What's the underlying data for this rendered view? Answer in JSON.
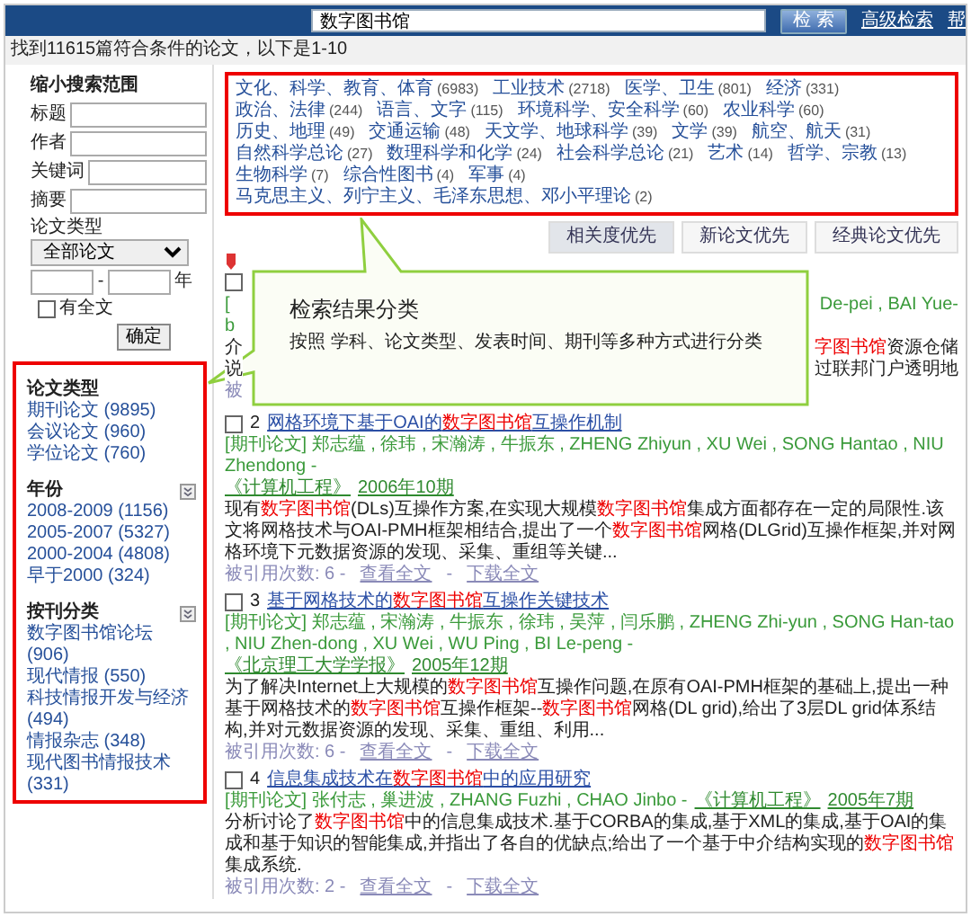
{
  "header": {
    "search_value": "数字图书馆",
    "search_button": "检 索",
    "links": [
      "高级检索",
      "帮"
    ]
  },
  "summary": "找到11615篇符合条件的论文，以下是1-10",
  "filter_form": {
    "title": "缩小搜索范围",
    "fields": [
      {
        "label": "标题"
      },
      {
        "label": "作者"
      },
      {
        "label": "关键词"
      },
      {
        "label": "摘要"
      }
    ],
    "type_label": "论文类型",
    "type_select": "全部论文",
    "year_separator": "-",
    "year_suffix": "年",
    "fulltext": {
      "label": "有全文",
      "checked": false
    },
    "submit": "确定"
  },
  "facets": [
    {
      "title": "论文类型",
      "collapsible": false,
      "items": [
        "期刊论文 (9895)",
        "会议论文 (960)",
        "学位论文 (760)"
      ]
    },
    {
      "title": "年份",
      "collapsible": true,
      "items": [
        "2008-2009 (1156)",
        "2005-2007 (5327)",
        "2000-2004 (4808)",
        "早于2000 (324)"
      ]
    },
    {
      "title": "按刊分类",
      "collapsible": true,
      "items": [
        "数字图书馆论坛 (906)",
        "现代情报 (550)",
        "科技情报开发与经济 (494)",
        "情报杂志 (348)",
        "现代图书情报技术 (331)"
      ]
    }
  ],
  "categories": [
    {
      "name": "文化、科学、教育、体育",
      "count": "(6983)"
    },
    {
      "name": "工业技术",
      "count": "(2718)"
    },
    {
      "name": "医学、卫生",
      "count": "(801)"
    },
    {
      "name": "经济",
      "count": "(331)"
    },
    {
      "name": "政治、法律",
      "count": "(244)"
    },
    {
      "name": "语言、文字",
      "count": "(115)"
    },
    {
      "name": "环境科学、安全科学",
      "count": "(60)"
    },
    {
      "name": "农业科学",
      "count": "(60)"
    },
    {
      "name": "历史、地理",
      "count": "(49)"
    },
    {
      "name": "交通运输",
      "count": "(48)"
    },
    {
      "name": "天文学、地球科学",
      "count": "(39)"
    },
    {
      "name": "文学",
      "count": "(39)"
    },
    {
      "name": "航空、航天",
      "count": "(31)"
    },
    {
      "name": "自然科学总论",
      "count": "(27)"
    },
    {
      "name": "数理科学和化学",
      "count": "(24)"
    },
    {
      "name": "社会科学总论",
      "count": "(21)"
    },
    {
      "name": "艺术",
      "count": "(14)"
    },
    {
      "name": "哲学、宗教",
      "count": "(13)"
    },
    {
      "name": "生物科学",
      "count": "(7)"
    },
    {
      "name": "综合性图书",
      "count": "(4)"
    },
    {
      "name": "军事",
      "count": "(4)"
    },
    {
      "name": "马克思主义、列宁主义、毛泽东思想、邓小平理论",
      "count": "(2)"
    }
  ],
  "sort_buttons": [
    {
      "label": "相关度优先",
      "selected": true
    },
    {
      "label": "新论文优先",
      "selected": false
    },
    {
      "label": "经典论文优先",
      "selected": false
    }
  ],
  "callout": {
    "title": "检索结果分类",
    "text": "按照 学科、论文类型、发表时间、期刊等多种方式进行分类"
  },
  "results": [
    {
      "kind": "partial",
      "checked": false,
      "lines": [
        {
          "kind": "authors",
          "left": "[",
          "right": [
            {
              "text": "De-pei , BAI Yue-",
              "hit": false
            }
          ]
        },
        {
          "kind": "authors",
          "left": "b"
        },
        {
          "kind": "abstract",
          "left": "介",
          "right": [
            {
              "text": "字图书馆",
              "hit": true
            },
            {
              "text": "资源仓储",
              "hit": false
            }
          ]
        },
        {
          "kind": "abstract",
          "left": "说",
          "right": [
            {
              "text": "过联邦门户透明地",
              "hit": false
            }
          ]
        },
        {
          "kind": "cite",
          "left": "被"
        }
      ]
    },
    {
      "kind": "full",
      "checked": false,
      "number": "2",
      "title": [
        {
          "text": "网格环境下基于OAI的",
          "hit": false
        },
        {
          "text": "数字图书馆",
          "hit": true
        },
        {
          "text": "互操作机制",
          "hit": false
        }
      ],
      "authors": "[期刊论文] 郑志蕴 , 徐玮 , 宋瀚涛 , 牛振东 , ZHENG Zhiyun , XU Wei , SONG Hantao , NIU Zhendong -",
      "journal": "《计算机工程》",
      "issue": "2006年10期",
      "abstract": [
        {
          "text": "现有",
          "hit": false
        },
        {
          "text": "数字图书馆",
          "hit": true
        },
        {
          "text": "(DLs)互操作方案,在实现大规模",
          "hit": false
        },
        {
          "text": "数字图书馆",
          "hit": true
        },
        {
          "text": "集成方面都存在一定的局限性.该文将网格技术与OAI-PMH框架相结合,提出了一个",
          "hit": false
        },
        {
          "text": "数字图书馆",
          "hit": true
        },
        {
          "text": "网格(DLGrid)互操作框架,并对网格环境下元数据资源的发现、采集、重组等关键...",
          "hit": false
        }
      ],
      "cited": "被引用次数: 6 -",
      "view_link": "查看全文",
      "separator": "-",
      "download_link": "下载全文"
    },
    {
      "kind": "full",
      "checked": false,
      "number": "3",
      "title": [
        {
          "text": "基于网格技术的",
          "hit": false
        },
        {
          "text": "数字图书馆",
          "hit": true
        },
        {
          "text": "互操作关键技术",
          "hit": false
        }
      ],
      "authors": "[期刊论文] 郑志蕴 , 宋瀚涛 , 牛振东 , 徐玮 , 吴萍 , 闫乐鹏 , ZHENG Zhi-yun , SONG Han-tao , NIU Zhen-dong , XU Wei , WU Ping , BI Le-peng -",
      "journal": "《北京理工大学学报》",
      "issue": "2005年12期",
      "abstract": [
        {
          "text": "为了解决Internet上大规模的",
          "hit": false
        },
        {
          "text": "数字图书馆",
          "hit": true
        },
        {
          "text": "互操作问题,在原有OAI-PMH框架的基础上,提出一种基于网格技术的",
          "hit": false
        },
        {
          "text": "数字图书馆",
          "hit": true
        },
        {
          "text": "互操作框架--",
          "hit": false
        },
        {
          "text": "数字图书馆",
          "hit": true
        },
        {
          "text": "网格(DL grid),给出了3层DL grid体系结构,并对元数据资源的发现、采集、重组、利用...",
          "hit": false
        }
      ],
      "cited": "被引用次数: 6 -",
      "view_link": "查看全文",
      "separator": "-",
      "download_link": "下载全文"
    },
    {
      "kind": "full",
      "checked": false,
      "number": "4",
      "title": [
        {
          "text": "信息集成技术在",
          "hit": false
        },
        {
          "text": "数字图书馆",
          "hit": true
        },
        {
          "text": "中的应用研究",
          "hit": false
        }
      ],
      "authors": "[期刊论文] 张付志 , 巢进波 , ZHANG Fuzhi , CHAO Jinbo -",
      "journal": "《计算机工程》",
      "issue": "2005年7期",
      "abstract": [
        {
          "text": "分析讨论了",
          "hit": false
        },
        {
          "text": "数字图书馆",
          "hit": true
        },
        {
          "text": "中的信息集成技术.基于CORBA的集成,基于XML的集成,基于OAI的集成和基于知识的智能集成,并指出了各自的优缺点;给出了一个基于中介结构实现的",
          "hit": false
        },
        {
          "text": "数字图书馆",
          "hit": true
        },
        {
          "text": "集成系统.",
          "hit": false
        }
      ],
      "cited": "被引用次数: 2 -",
      "view_link": "查看全文",
      "separator": "-",
      "download_link": "下载全文"
    }
  ]
}
